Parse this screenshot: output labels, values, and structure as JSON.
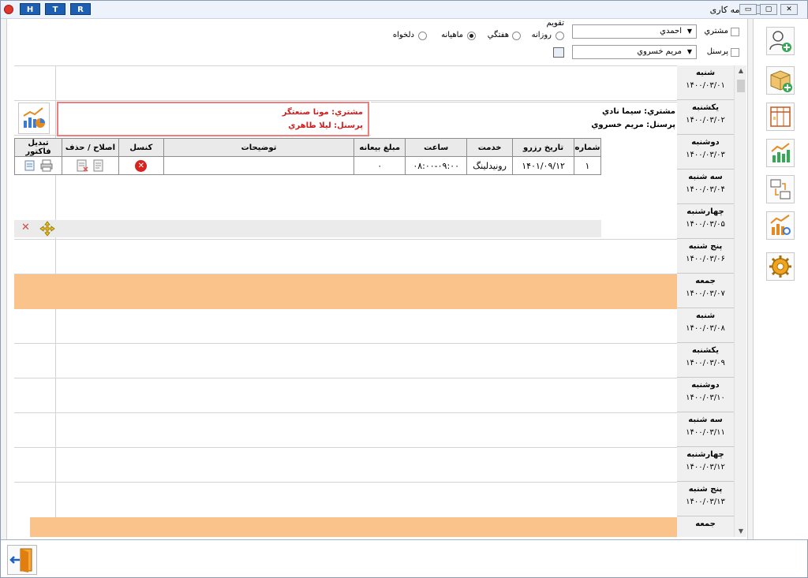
{
  "titlebar": {
    "title": "برنامه کاری",
    "buttons": [
      "H",
      "T",
      "R"
    ]
  },
  "filters": {
    "customer_label": "مشتري",
    "customer_value": "احمدي",
    "staff_label": "پرسنل",
    "staff_value": "مريم خسروي",
    "calendar_group": "تقويم",
    "views": [
      "روزانه",
      "هفتگي",
      "ماهيانه",
      "دلخواه"
    ],
    "selected_view": "ماهيانه"
  },
  "days": [
    {
      "name": "شنبه",
      "date": "۱۴۰۰/۰۳/۰۱"
    },
    {
      "name": "يكشنبه",
      "date": "۱۴۰۰/۰۳/۰۲"
    },
    {
      "name": "دوشنبه",
      "date": "۱۴۰۰/۰۳/۰۳"
    },
    {
      "name": "سه شنبه",
      "date": "۱۴۰۰/۰۳/۰۴"
    },
    {
      "name": "چهارشنبه",
      "date": "۱۴۰۰/۰۳/۰۵"
    },
    {
      "name": "پنج شنبه",
      "date": "۱۴۰۰/۰۳/۰۶"
    },
    {
      "name": "جمعه",
      "date": "۱۴۰۰/۰۳/۰۷"
    },
    {
      "name": "شنبه",
      "date": "۱۴۰۰/۰۳/۰۸"
    },
    {
      "name": "يكشنبه",
      "date": "۱۴۰۰/۰۳/۰۹"
    },
    {
      "name": "دوشنبه",
      "date": "۱۴۰۰/۰۳/۱۰"
    },
    {
      "name": "سه شنبه",
      "date": "۱۴۰۰/۰۳/۱۱"
    },
    {
      "name": "چهارشنبه",
      "date": "۱۴۰۰/۰۳/۱۲"
    },
    {
      "name": "پنج شنبه",
      "date": "۱۴۰۰/۰۳/۱۳"
    },
    {
      "name": "جمعه",
      "date": ""
    }
  ],
  "appointment_left": {
    "customer": "مشتري: مونا صنعتگر",
    "staff": "پرسنل: ليلا طاهري"
  },
  "appointment_right": {
    "customer": "مشتري: سيما نادي",
    "staff": "پرسنل: مريم خسروي"
  },
  "grid": {
    "headers": [
      "شماره",
      "تاريخ رزرو",
      "خدمت",
      "ساعت",
      "مبلغ بيعانه",
      "توضيحات",
      "كنسل",
      "اصلاح / حذف",
      "تبديل فاكتور"
    ],
    "rows": [
      {
        "no": "۱",
        "date": "۱۴۰۱/۰۹/۱۲",
        "service": "رونيدلينگ",
        "time": "۰۸:۰۰-۰۹:۰۰",
        "deposit": "۰",
        "desc": ""
      }
    ]
  },
  "colors": {
    "friday_fill": "#fbc38c",
    "note_border": "#f27d7d",
    "note_text": "#d21b1b"
  },
  "icons": {
    "sidebar": [
      "add-customer-icon",
      "add-package-icon",
      "table-icon",
      "chart-icon",
      "transfer-icon",
      "report-icon",
      "settings-icon"
    ],
    "exit": "exit-door-icon"
  }
}
